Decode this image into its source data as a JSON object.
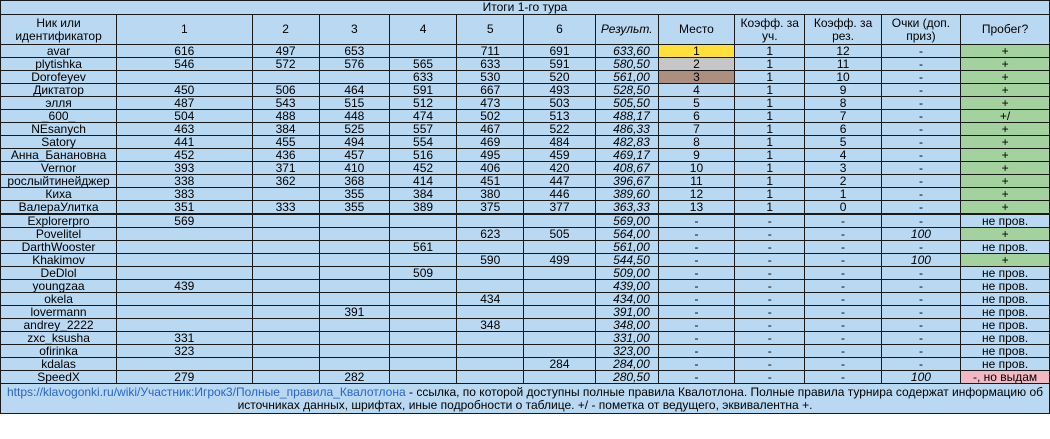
{
  "table_title": "Итоги 1-го тура",
  "headers": {
    "name": "Ник или идентификатор",
    "r1": "1",
    "r2": "2",
    "r3": "3",
    "r4": "4",
    "r5": "5",
    "r6": "6",
    "result": "Результ.",
    "place": "Место",
    "coef_part": "Коэфф. за уч.",
    "coef_res": "Коэфф. за рез.",
    "points": "Очки (доп. приз)",
    "run": "Пробег?"
  },
  "rows": [
    {
      "name": "avar",
      "r": [
        "616",
        "497",
        "653",
        "",
        "711",
        "691"
      ],
      "res": "633,60",
      "place": "1",
      "k1": "1",
      "k2": "12",
      "pts": "-",
      "run": "+",
      "pc": "gold",
      "rc": "green"
    },
    {
      "name": "plytishka",
      "r": [
        "546",
        "572",
        "576",
        "565",
        "633",
        "591"
      ],
      "res": "580,50",
      "place": "2",
      "k1": "1",
      "k2": "11",
      "pts": "-",
      "run": "+",
      "pc": "silver",
      "rc": "green"
    },
    {
      "name": "Dorofeyev",
      "r": [
        "",
        "",
        "",
        "633",
        "530",
        "520"
      ],
      "res": "561,00",
      "place": "3",
      "k1": "1",
      "k2": "10",
      "pts": "-",
      "run": "+",
      "pc": "bronze",
      "rc": "green"
    },
    {
      "name": "Диктатор",
      "r": [
        "450",
        "506",
        "464",
        "591",
        "667",
        "493"
      ],
      "res": "528,50",
      "place": "4",
      "k1": "1",
      "k2": "9",
      "pts": "-",
      "run": "+",
      "pc": "blue",
      "rc": "green"
    },
    {
      "name": "элля",
      "r": [
        "487",
        "543",
        "515",
        "512",
        "473",
        "503"
      ],
      "res": "505,50",
      "place": "5",
      "k1": "1",
      "k2": "8",
      "pts": "-",
      "run": "+",
      "pc": "blue",
      "rc": "green"
    },
    {
      "name": "_600_",
      "r": [
        "504",
        "488",
        "448",
        "474",
        "502",
        "513"
      ],
      "res": "488,17",
      "place": "6",
      "k1": "1",
      "k2": "7",
      "pts": "-",
      "run": "+/",
      "pc": "blue",
      "rc": "green"
    },
    {
      "name": "NEsanych",
      "r": [
        "463",
        "384",
        "525",
        "557",
        "467",
        "522"
      ],
      "res": "486,33",
      "place": "7",
      "k1": "1",
      "k2": "6",
      "pts": "-",
      "run": "+",
      "pc": "blue",
      "rc": "green"
    },
    {
      "name": "Satory",
      "r": [
        "441",
        "455",
        "494",
        "554",
        "469",
        "484"
      ],
      "res": "482,83",
      "place": "8",
      "k1": "1",
      "k2": "5",
      "pts": "-",
      "run": "+",
      "pc": "blue",
      "rc": "green"
    },
    {
      "name": "Анна_Банановна",
      "r": [
        "452",
        "436",
        "457",
        "516",
        "495",
        "459"
      ],
      "res": "469,17",
      "place": "9",
      "k1": "1",
      "k2": "4",
      "pts": "-",
      "run": "+",
      "pc": "blue",
      "rc": "green"
    },
    {
      "name": "Vernor",
      "r": [
        "393",
        "371",
        "410",
        "452",
        "406",
        "420"
      ],
      "res": "408,67",
      "place": "10",
      "k1": "1",
      "k2": "3",
      "pts": "-",
      "run": "+",
      "pc": "blue",
      "rc": "green"
    },
    {
      "name": "рослыйтинейджер",
      "r": [
        "338",
        "362",
        "368",
        "414",
        "451",
        "447"
      ],
      "res": "396,67",
      "place": "11",
      "k1": "1",
      "k2": "2",
      "pts": "-",
      "run": "+",
      "pc": "blue",
      "rc": "green"
    },
    {
      "name": "Киха",
      "r": [
        "383",
        "",
        "355",
        "384",
        "380",
        "446"
      ],
      "res": "389,60",
      "place": "12",
      "k1": "1",
      "k2": "1",
      "pts": "-",
      "run": "+",
      "pc": "blue",
      "rc": "green"
    },
    {
      "name": "ВалераУлитка",
      "r": [
        "351",
        "333",
        "355",
        "389",
        "375",
        "377"
      ],
      "res": "363,33",
      "place": "13",
      "k1": "1",
      "k2": "0",
      "pts": "-",
      "run": "+",
      "pc": "blue",
      "rc": "green"
    },
    {
      "name": "Explorerpro",
      "r": [
        "569",
        "",
        "",
        "",
        "",
        ""
      ],
      "res": "569,00",
      "place": "-",
      "k1": "-",
      "k2": "-",
      "pts": "-",
      "run": "не пров.",
      "pc": "blue",
      "rc": "blue",
      "sep": true
    },
    {
      "name": "Povelitel",
      "r": [
        "",
        "",
        "",
        "",
        "623",
        "505"
      ],
      "res": "564,00",
      "place": "-",
      "k1": "-",
      "k2": "-",
      "pts": "100",
      "run": "+",
      "pc": "blue",
      "rc": "green",
      "ip": true
    },
    {
      "name": "DarthWooster",
      "r": [
        "",
        "",
        "",
        "561",
        "",
        ""
      ],
      "res": "561,00",
      "place": "-",
      "k1": "-",
      "k2": "-",
      "pts": "-",
      "run": "не пров.",
      "pc": "blue",
      "rc": "blue"
    },
    {
      "name": "Khakimov",
      "r": [
        "",
        "",
        "",
        "",
        "590",
        "499"
      ],
      "res": "544,50",
      "place": "-",
      "k1": "-",
      "k2": "-",
      "pts": "100",
      "run": "+",
      "pc": "blue",
      "rc": "green",
      "ip": true
    },
    {
      "name": "DeDlol",
      "r": [
        "",
        "",
        "",
        "509",
        "",
        ""
      ],
      "res": "509,00",
      "place": "-",
      "k1": "-",
      "k2": "-",
      "pts": "-",
      "run": "не пров.",
      "pc": "blue",
      "rc": "blue"
    },
    {
      "name": "youngzaa",
      "r": [
        "439",
        "",
        "",
        "",
        "",
        ""
      ],
      "res": "439,00",
      "place": "-",
      "k1": "-",
      "k2": "-",
      "pts": "-",
      "run": "не пров.",
      "pc": "blue",
      "rc": "blue"
    },
    {
      "name": "okela",
      "r": [
        "",
        "",
        "",
        "",
        "434",
        ""
      ],
      "res": "434,00",
      "place": "-",
      "k1": "-",
      "k2": "-",
      "pts": "-",
      "run": "не пров.",
      "pc": "blue",
      "rc": "blue"
    },
    {
      "name": "lovermann",
      "r": [
        "",
        "",
        "391",
        "",
        "",
        ""
      ],
      "res": "391,00",
      "place": "-",
      "k1": "-",
      "k2": "-",
      "pts": "-",
      "run": "не пров.",
      "pc": "blue",
      "rc": "blue"
    },
    {
      "name": "andrey_2222",
      "r": [
        "",
        "",
        "",
        "",
        "348",
        ""
      ],
      "res": "348,00",
      "place": "-",
      "k1": "-",
      "k2": "-",
      "pts": "-",
      "run": "не пров.",
      "pc": "blue",
      "rc": "blue"
    },
    {
      "name": "zxc_ksusha",
      "r": [
        "331",
        "",
        "",
        "",
        "",
        ""
      ],
      "res": "331,00",
      "place": "-",
      "k1": "-",
      "k2": "-",
      "pts": "-",
      "run": "не пров.",
      "pc": "blue",
      "rc": "blue"
    },
    {
      "name": "ofirinka",
      "r": [
        "323",
        "",
        "",
        "",
        "",
        ""
      ],
      "res": "323,00",
      "place": "-",
      "k1": "-",
      "k2": "-",
      "pts": "-",
      "run": "не пров.",
      "pc": "blue",
      "rc": "blue"
    },
    {
      "name": "kdalas",
      "r": [
        "",
        "",
        "",
        "",
        "",
        "284"
      ],
      "res": "284,00",
      "place": "-",
      "k1": "-",
      "k2": "-",
      "pts": "-",
      "run": "не пров.",
      "pc": "blue",
      "rc": "blue"
    },
    {
      "name": "SpeedX",
      "r": [
        "279",
        "",
        "282",
        "",
        "",
        ""
      ],
      "res": "280,50",
      "place": "-",
      "k1": "-",
      "k2": "-",
      "pts": "100",
      "run": "-, но выдам",
      "pc": "blue",
      "rc": "pink",
      "ip": true
    }
  ],
  "footer": {
    "link_text": "https://klavogonki.ru/wiki/Участник:Игрок3/Полные_правила_Квалотлона",
    "text": " - ссылка, по которой доступны полные правила Квалотлона. Полные правила турнира содержат информацию об источниках данных, шрифтах, иные подробности о таблице. +/ - пометка от ведущего, эквивалентна +."
  },
  "colors": {
    "cell_blue": "#b9d8f2",
    "green": "#a3d29e",
    "pink": "#f3b9c3",
    "gold": "#ffe03a",
    "silver": "#c6c6c6",
    "bronze": "#ad8f7f",
    "link": "#2a64c8"
  }
}
